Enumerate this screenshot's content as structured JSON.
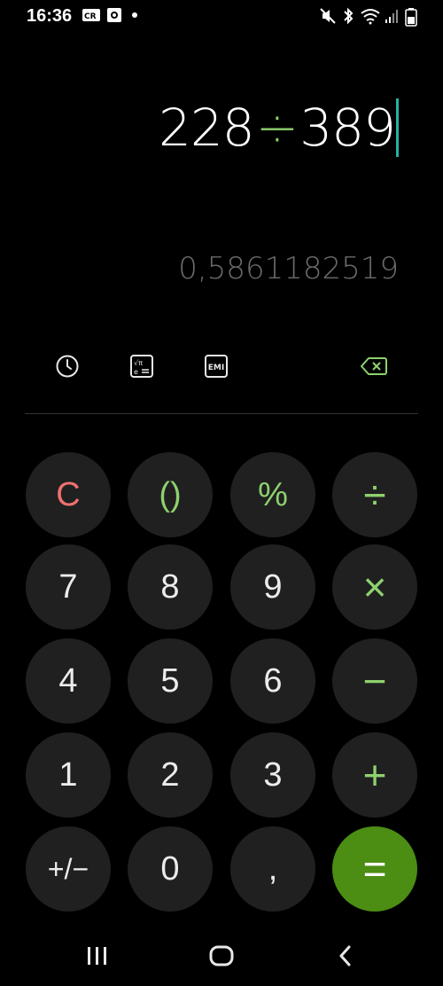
{
  "status_bar": {
    "time": "16:36",
    "left_icons": [
      "cr-icon",
      "screenshot-icon",
      "notification-dot"
    ],
    "right_icons": [
      "mute-icon",
      "bluetooth-icon",
      "wifi-icon",
      "signal-icon",
      "battery-icon"
    ]
  },
  "display": {
    "operand1": "228",
    "operator": "÷",
    "operand2": "389",
    "result": "0,5861182519"
  },
  "toolbar": {
    "history_icon": "clock-icon",
    "scientific_icon": "scientific-icon",
    "emi_label": "EMI",
    "backspace_icon": "backspace-icon"
  },
  "keypad": {
    "rows": [
      [
        {
          "label": "C",
          "name": "clear"
        },
        {
          "label": "()",
          "name": "parentheses"
        },
        {
          "label": "%",
          "name": "percent"
        },
        {
          "label": "÷",
          "name": "divide"
        }
      ],
      [
        {
          "label": "7",
          "name": "7"
        },
        {
          "label": "8",
          "name": "8"
        },
        {
          "label": "9",
          "name": "9"
        },
        {
          "label": "×",
          "name": "multiply"
        }
      ],
      [
        {
          "label": "4",
          "name": "4"
        },
        {
          "label": "5",
          "name": "5"
        },
        {
          "label": "6",
          "name": "6"
        },
        {
          "label": "−",
          "name": "minus"
        }
      ],
      [
        {
          "label": "1",
          "name": "1"
        },
        {
          "label": "2",
          "name": "2"
        },
        {
          "label": "3",
          "name": "3"
        },
        {
          "label": "+",
          "name": "plus"
        }
      ],
      [
        {
          "label": "+/−",
          "name": "plus-minus"
        },
        {
          "label": "0",
          "name": "0"
        },
        {
          "label": ",",
          "name": "decimal"
        },
        {
          "label": "=",
          "name": "equals"
        }
      ]
    ]
  },
  "navbar": {
    "recents": "recents-icon",
    "home": "home-icon",
    "back": "back-icon"
  },
  "colors": {
    "background": "#000000",
    "key_background": "#202020",
    "operator_green": "#8ed16e",
    "clear_red": "#f07070",
    "equals_background": "#4c8d14",
    "result_gray": "#6b6b6b",
    "cursor": "#2ab0a0"
  }
}
